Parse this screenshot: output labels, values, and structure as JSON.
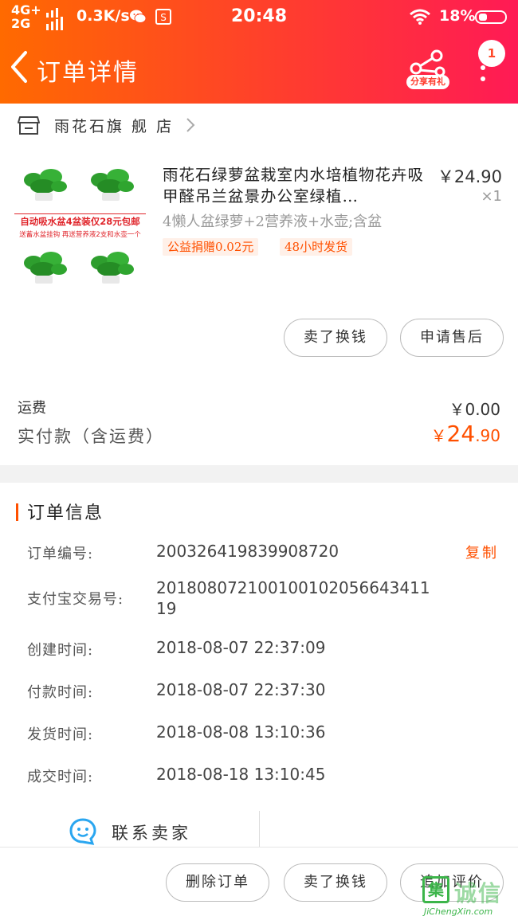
{
  "status_bar": {
    "network_top": "4G+",
    "network_bottom": "2G",
    "speed": "0.3K/s",
    "time": "20:48",
    "battery": "18%"
  },
  "header": {
    "title": "订单详情",
    "share_label": "分享有礼",
    "message_badge": "1"
  },
  "shop": {
    "name": "雨花石旗 舰 店"
  },
  "product": {
    "image_banner": "自动吸水盆4盆装仅28元包邮",
    "image_subbanner": "送蓄水盆挂钩  再送营养液2支和水壶一个",
    "title": "雨花石绿萝盆栽室内水培植物花卉吸甲醛吊兰盆景办公室绿植…",
    "price": "￥24.90",
    "quantity": "×1",
    "sku": "4懒人盆绿萝+2营养液+水壶;含盆",
    "tags": [
      "公益捐赠0.02元",
      "48小时发货"
    ],
    "buttons": [
      "卖了换钱",
      "申请售后"
    ]
  },
  "summary": {
    "shipping_label": "运费",
    "shipping_value": "￥0.00",
    "paid_label": "实付款（含运费）",
    "paid_currency": "￥",
    "paid_int": "24",
    "paid_dec": ".90"
  },
  "order_info": {
    "title": "订单信息",
    "copy_label": "复制",
    "rows": [
      {
        "label": "订单编号:",
        "value": "200326419839908720"
      },
      {
        "label": "支付宝交易号:",
        "value": "20180807210010010205664341119"
      },
      {
        "label": "创建时间:",
        "value": "2018-08-07 22:37:09"
      },
      {
        "label": "付款时间:",
        "value": "2018-08-07 22:37:30"
      },
      {
        "label": "发货时间:",
        "value": "2018-08-08 13:10:36"
      },
      {
        "label": "成交时间:",
        "value": "2018-08-18 13:10:45"
      }
    ]
  },
  "contact": {
    "label": "联系卖家"
  },
  "footer": {
    "buttons": [
      "删除订单",
      "卖了换钱",
      "追加评价"
    ]
  },
  "watermark": {
    "text": "诚信",
    "url": "JiChengXin.com"
  },
  "colors": {
    "accent": "#ff5000",
    "header_start": "#ff6a00",
    "header_end": "#ff1a55"
  }
}
